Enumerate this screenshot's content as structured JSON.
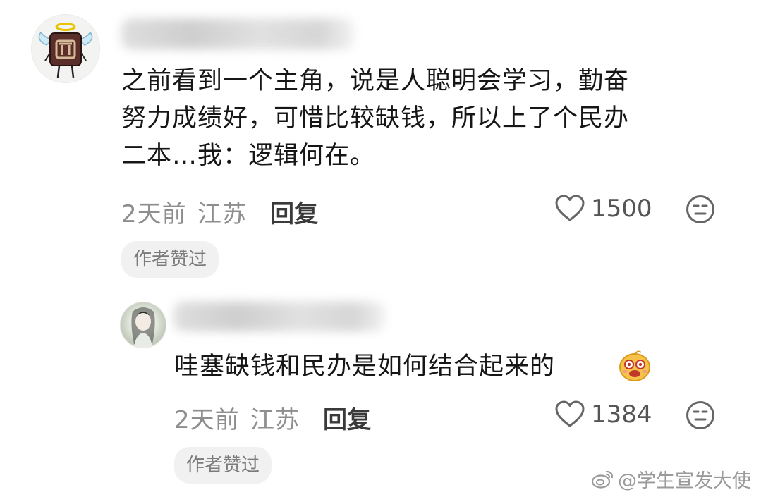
{
  "comments": [
    {
      "text_lines": [
        "之前看到一个主角，说是人聪明会学习，勤奋",
        "努力成绩好，可惜比较缺钱，所以上了个民办",
        "二本…我：逻辑何在。"
      ],
      "time": "2天前",
      "location": "江苏",
      "reply_label": "回复",
      "likes": "1500",
      "badge": "作者赞过",
      "icons": [
        "angel-avatar-icon",
        "heart-outline-icon",
        "meh-face-icon"
      ]
    },
    {
      "text": "哇塞缺钱和民办是如何结合起来的",
      "emoji": "drooling-doge-icon",
      "time": "2天前",
      "location": "江苏",
      "reply_label": "回复",
      "likes": "1384",
      "badge": "作者赞过",
      "icons": [
        "heart-outline-icon",
        "meh-face-icon"
      ]
    }
  ],
  "watermark": {
    "text": "@学生宣发大使",
    "icon": "weibo-logo-icon"
  }
}
